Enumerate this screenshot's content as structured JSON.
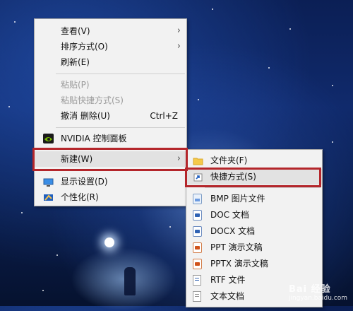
{
  "context_menu": {
    "items": [
      {
        "label": "查看(V)",
        "submenu": true
      },
      {
        "label": "排序方式(O)",
        "submenu": true
      },
      {
        "label": "刷新(E)"
      },
      {
        "label": "粘贴(P)",
        "disabled": true
      },
      {
        "label": "粘贴快捷方式(S)",
        "disabled": true
      },
      {
        "label": "撤消 删除(U)",
        "accel": "Ctrl+Z"
      },
      {
        "label": "NVIDIA 控制面板",
        "icon": "nvidia-icon"
      },
      {
        "label": "新建(W)",
        "submenu": true,
        "highlighted": true
      },
      {
        "label": "显示设置(D)",
        "icon": "display-settings-icon"
      },
      {
        "label": "个性化(R)",
        "icon": "personalize-icon"
      }
    ]
  },
  "new_submenu": {
    "items": [
      {
        "label": "文件夹(F)",
        "icon": "folder-icon"
      },
      {
        "label": "快捷方式(S)",
        "icon": "shortcut-icon",
        "highlighted": true
      },
      {
        "label": "BMP 图片文件",
        "icon": "bmp-file-icon"
      },
      {
        "label": "DOC 文档",
        "icon": "doc-file-icon"
      },
      {
        "label": "DOCX 文档",
        "icon": "docx-file-icon"
      },
      {
        "label": "PPT 演示文稿",
        "icon": "ppt-file-icon"
      },
      {
        "label": "PPTX 演示文稿",
        "icon": "pptx-file-icon"
      },
      {
        "label": "RTF 文件",
        "icon": "rtf-file-icon"
      },
      {
        "label": "文本文档",
        "icon": "text-file-icon"
      }
    ]
  },
  "annotation_color": "#b4262b",
  "watermark": {
    "text": "Bai 经验",
    "sub": "jingyan.baidu.com"
  }
}
